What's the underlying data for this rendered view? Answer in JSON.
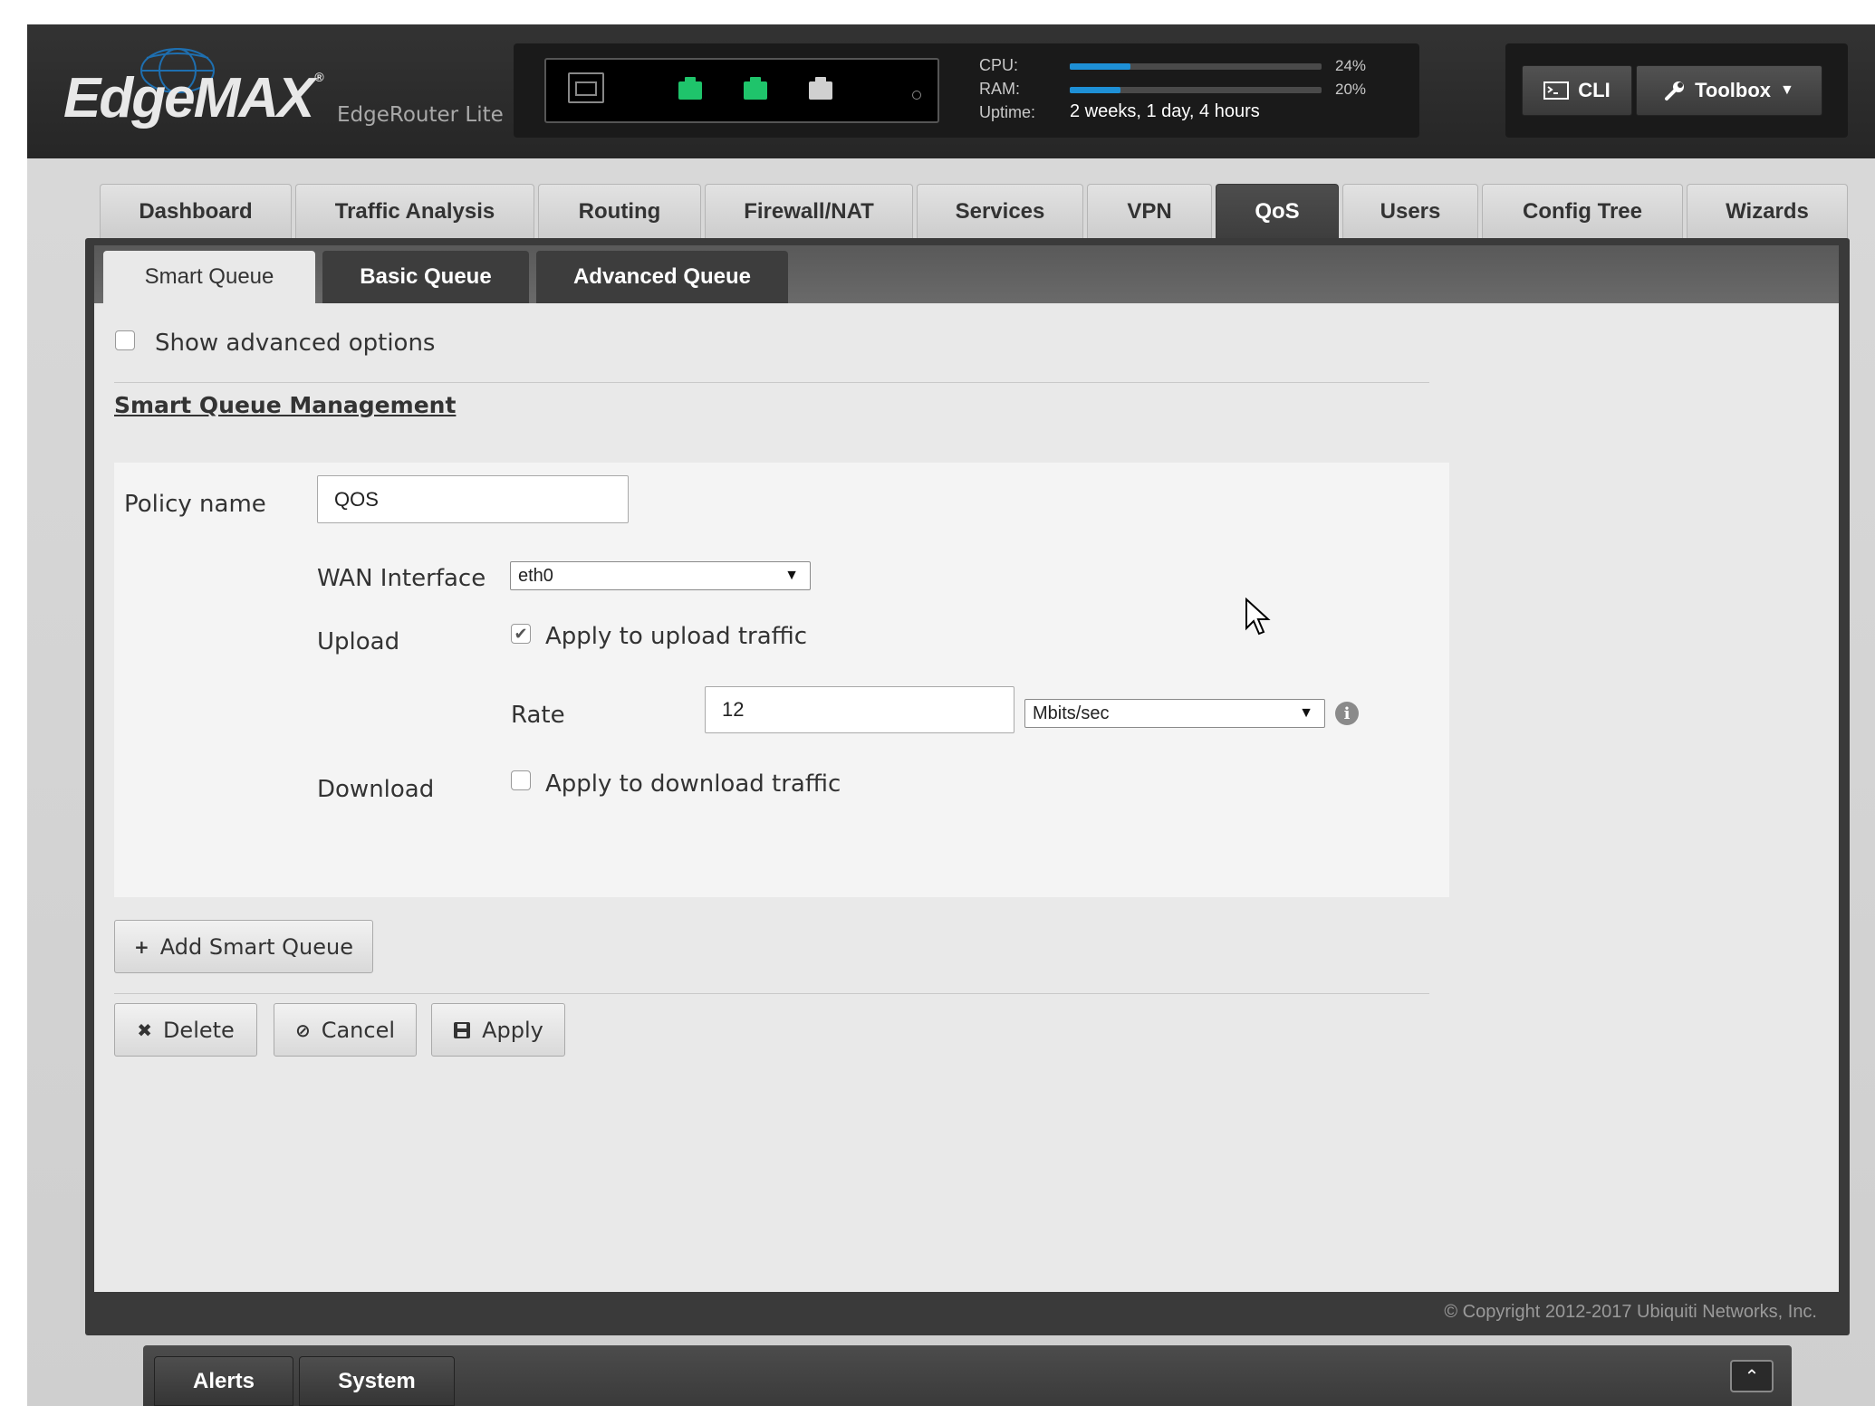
{
  "header": {
    "logo_text": "EdgeMAX",
    "logo_mark": "®",
    "model": "EdgeRouter Lite v",
    "cpu_label": "CPU:",
    "cpu_pct": "24%",
    "cpu_value": 0.24,
    "ram_label": "RAM:",
    "ram_pct": "20%",
    "ram_value": 0.2,
    "uptime_label": "Uptime:",
    "uptime_value": "2 weeks, 1 day, 4 hours",
    "cli_label": "CLI",
    "toolbox_label": "Toolbox",
    "port_colors": [
      "#1fc46b",
      "#1fc46b",
      "#d0d0d0"
    ]
  },
  "nav": {
    "tabs": [
      "Dashboard",
      "Traffic Analysis",
      "Routing",
      "Firewall/NAT",
      "Services",
      "VPN",
      "QoS",
      "Users",
      "Config Tree",
      "Wizards"
    ],
    "active": "QoS"
  },
  "subtabs": {
    "smart": "Smart Queue",
    "basic": "Basic Queue",
    "advanced": "Advanced Queue"
  },
  "form": {
    "show_advanced": "Show advanced options",
    "section_title": "Smart Queue Management",
    "policy_label": "Policy name",
    "policy_value": "QOS",
    "wan_label": "WAN Interface",
    "wan_value": "eth0",
    "upload_label": "Upload",
    "upload_check": "Apply to upload traffic",
    "rate_label": "Rate",
    "rate_value": "12",
    "rate_unit": "Mbits/sec",
    "download_label": "Download",
    "download_check": "Apply to download traffic"
  },
  "buttons": {
    "add": "Add Smart Queue",
    "delete": "Delete",
    "cancel": "Cancel",
    "apply": "Apply"
  },
  "footer": {
    "copyright": "© Copyright 2012-2017 Ubiquiti Networks, Inc.",
    "alerts": "Alerts",
    "system": "System"
  },
  "colors": {
    "accent": "#1e90d6",
    "port_active": "#1fc46b"
  }
}
